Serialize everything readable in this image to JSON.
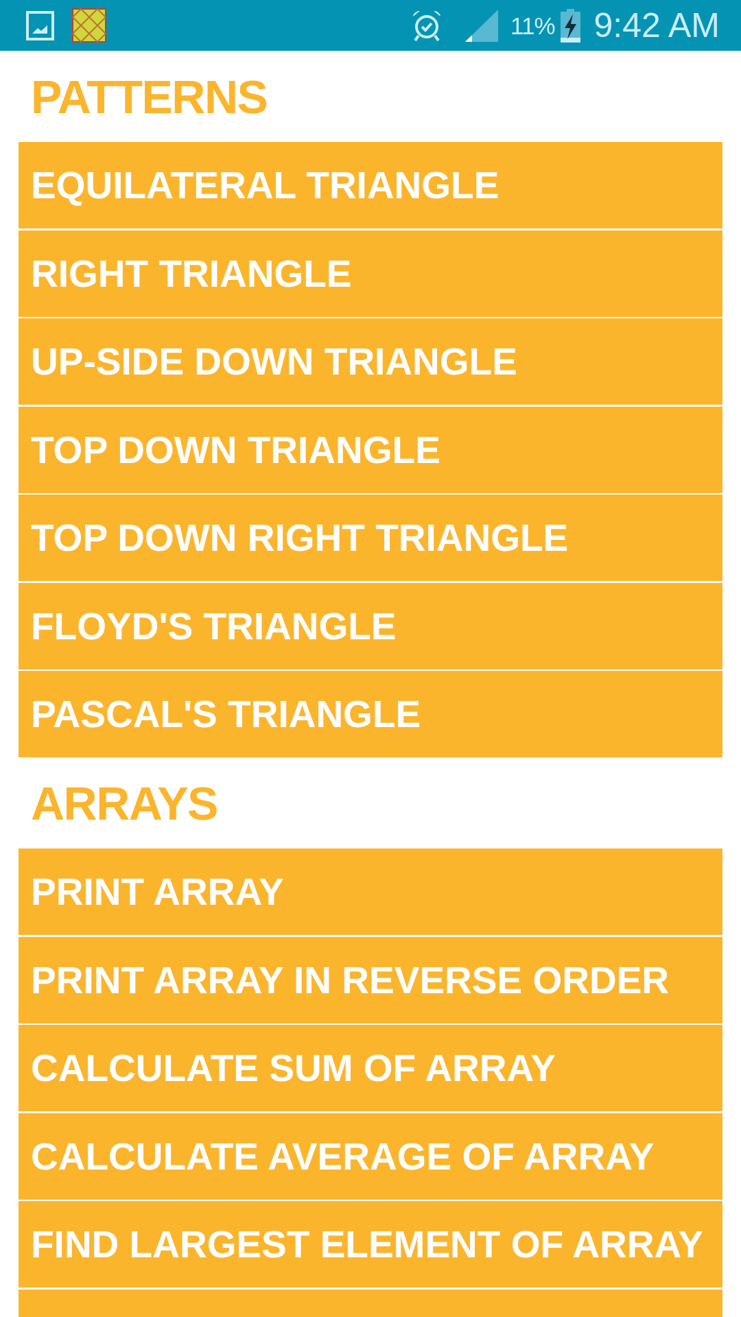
{
  "status_bar": {
    "battery": "11%",
    "time": "9:42 AM"
  },
  "sections": [
    {
      "title": "PATTERNS",
      "items": [
        "EQUILATERAL TRIANGLE",
        "RIGHT TRIANGLE",
        "UP-SIDE DOWN TRIANGLE",
        "TOP DOWN TRIANGLE",
        "TOP DOWN RIGHT TRIANGLE",
        "FLOYD'S TRIANGLE",
        "PASCAL'S TRIANGLE"
      ]
    },
    {
      "title": "ARRAYS",
      "items": [
        "PRINT ARRAY",
        "PRINT ARRAY IN REVERSE ORDER",
        "CALCULATE SUM OF ARRAY",
        "CALCULATE AVERAGE OF ARRAY",
        "FIND LARGEST ELEMENT OF ARRAY"
      ],
      "cut_off_row": true
    }
  ]
}
